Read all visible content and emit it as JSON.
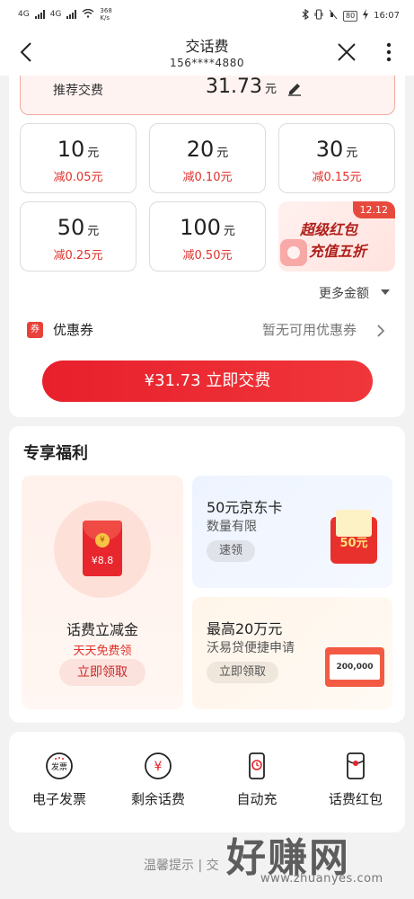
{
  "status_bar": {
    "net_left1": "4G",
    "net_left2": "4G",
    "speed": "368\nK/s",
    "battery": "80",
    "time": "16:07"
  },
  "nav": {
    "title": "交话费",
    "phone": "156****4880"
  },
  "recommend": {
    "label": "推荐交费",
    "amount": "31.73",
    "unit": "元"
  },
  "amounts": [
    {
      "value": "10",
      "unit": "元",
      "discount": "减0.05元"
    },
    {
      "value": "20",
      "unit": "元",
      "discount": "减0.10元"
    },
    {
      "value": "30",
      "unit": "元",
      "discount": "减0.15元"
    },
    {
      "value": "50",
      "unit": "元",
      "discount": "减0.25元"
    },
    {
      "value": "100",
      "unit": "元",
      "discount": "减0.50元"
    }
  ],
  "promo": {
    "badge": "12.12",
    "line1": "超级红包",
    "line2": "充值五折"
  },
  "more_amount": "更多金额",
  "coupon": {
    "icon_text": "券",
    "label": "优惠券",
    "status": "暂无可用优惠券"
  },
  "pay_button": "¥31.73 立即交费",
  "benefits": {
    "title": "专享福利",
    "left": {
      "envelope_value": "¥8.8",
      "coin": "¥",
      "title": "话费立减金",
      "subtitle": "天天免费领",
      "button": "立即领取"
    },
    "right_top": {
      "title": "50元京东卡",
      "subtitle": "数量有限",
      "button": "速领",
      "card_text": "50元"
    },
    "right_bottom": {
      "title": "最高20万元",
      "subtitle": "沃易贷便捷申请",
      "button": "立即领取",
      "box_text": "200,000"
    }
  },
  "shortcuts": [
    {
      "label": "电子发票",
      "icon": "invoice-icon",
      "icon_text": "发票"
    },
    {
      "label": "剩余话费",
      "icon": "yuan-icon",
      "icon_text": "¥"
    },
    {
      "label": "自动充",
      "icon": "auto-recharge-icon",
      "icon_text": ""
    },
    {
      "label": "话费红包",
      "icon": "red-envelope-icon",
      "icon_text": ""
    }
  ],
  "tip": "温馨提示 | 交",
  "watermark": {
    "main": "好赚网",
    "url": "www.zhuanyes.com"
  },
  "colors": {
    "accent": "#e8202c",
    "discount_red": "#e0312b"
  }
}
